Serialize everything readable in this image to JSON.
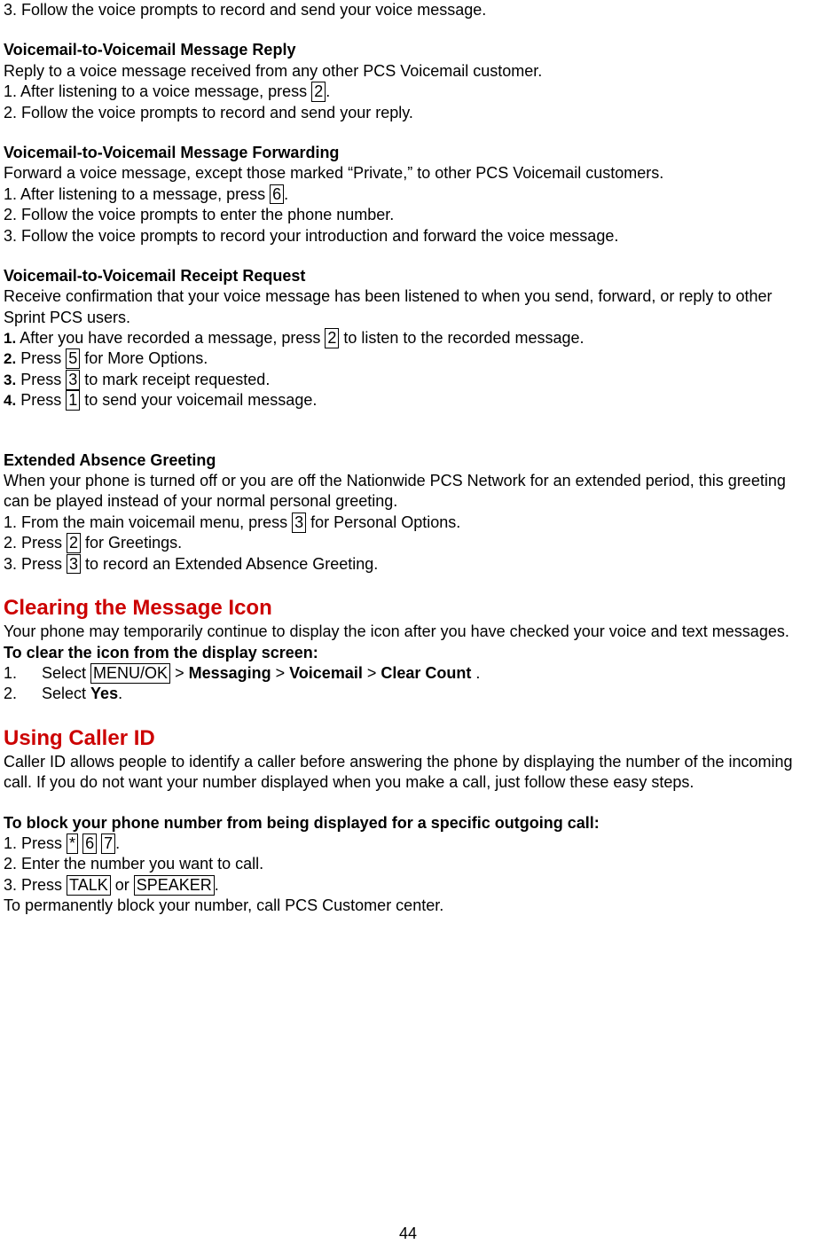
{
  "intro_step": {
    "num": "3.",
    "text": " Follow the voice prompts to record and send your voice message."
  },
  "reply": {
    "heading": "Voicemail-to-Voicemail Message Reply",
    "desc": "Reply to a voice message received from any other PCS Voicemail customer.",
    "s1_pre": "1. After listening to a voice message, press ",
    "s1_key": "2",
    "s1_post": ".",
    "s2": "2. Follow the voice prompts to record and send your reply."
  },
  "forwarding": {
    "heading": "Voicemail-to-Voicemail Message Forwarding",
    "desc": "Forward a voice message, except those marked “Private,” to other PCS Voicemail customers.",
    "s1_pre": "1. After listening to a message, press ",
    "s1_key": "6",
    "s1_post": ".",
    "s2": "2. Follow the voice prompts to enter the phone number.",
    "s3": "3. Follow the voice prompts to record your introduction and forward the voice message."
  },
  "receipt": {
    "heading": "Voicemail-to-Voicemail Receipt Request",
    "desc": "Receive confirmation that your voice message has been listened to when you send, forward, or reply to other Sprint PCS users.",
    "s1_num": "1.",
    "s1_pre": " After you have recorded a message, press ",
    "s1_key": "2",
    "s1_post": " to listen to the recorded message.",
    "s2_num": "2.",
    "s2_pre": " Press ",
    "s2_key": "5",
    "s2_post": " for More Options.",
    "s3_num": "3.",
    "s3_pre": " Press ",
    "s3_key": "3",
    "s3_post": " to mark receipt requested.",
    "s4_num": "4.",
    "s4_pre": " Press ",
    "s4_key": "1",
    "s4_post": " to send your voicemail message."
  },
  "extended": {
    "heading": "Extended Absence Greeting",
    "desc": "When your phone is turned off or you are off the Nationwide PCS Network for an extended period, this greeting can be played instead of your normal personal greeting.",
    "s1_pre": "1. From the main voicemail menu, press ",
    "s1_key": "3",
    "s1_post": " for Personal Options.",
    "s2_pre": "2. Press ",
    "s2_key": "2",
    "s2_post": " for Greetings.",
    "s3_pre": "3. Press ",
    "s3_key": "3",
    "s3_post": " to record an Extended Absence Greeting."
  },
  "clearing": {
    "heading": "Clearing the Message Icon",
    "desc": "Your phone may temporarily continue to display the icon after you have checked your voice and text messages.",
    "subhead": "To clear the icon from the display screen:",
    "s1_num": "1.",
    "s1_sel": "Select ",
    "s1_key": "MENU/OK",
    "s1_gt1": " > ",
    "s1_b1": "Messaging",
    "s1_gt2": " > ",
    "s1_b2": "Voicemail",
    "s1_gt3": " > ",
    "s1_b3": "Clear Count",
    "s1_post": " .",
    "s2_num": "2.",
    "s2_sel": "Select ",
    "s2_b": "Yes",
    "s2_post": "."
  },
  "callerid": {
    "heading": "Using Caller ID",
    "desc": "Caller ID allows people to identify a caller before answering the phone by displaying the number of the incoming call. If you do not want your number displayed when you make a call, just follow these easy steps.",
    "subhead": "To block your phone number from being displayed for a specific outgoing call:",
    "s1_pre": "1. Press ",
    "s1_k1": "*",
    "s1_sp1": " ",
    "s1_k2": "6",
    "s1_sp2": " ",
    "s1_k3": "7",
    "s1_post": ".",
    "s2": "2. Enter the number you want to call.",
    "s3_pre": "3. Press ",
    "s3_k1": "TALK",
    "s3_mid": " or ",
    "s3_k2": "SPEAKER",
    "s3_post": ".",
    "tail": "To permanently block your number, call PCS Customer center."
  },
  "page_number": "44"
}
